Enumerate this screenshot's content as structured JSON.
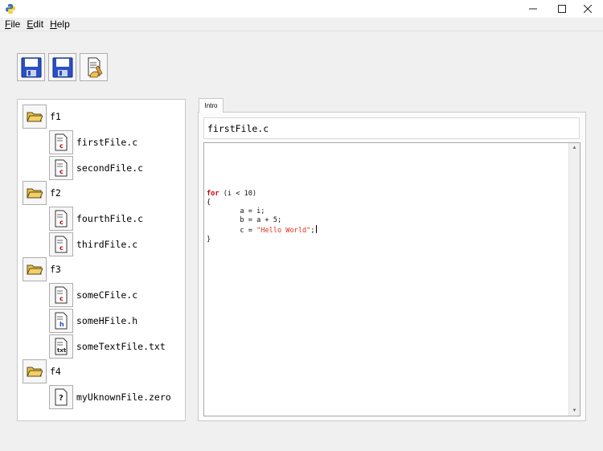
{
  "window": {
    "controls": {
      "minimize": "minimize-icon",
      "maximize": "maximize-icon",
      "close": "close-icon"
    }
  },
  "menu": [
    {
      "label": "File",
      "mnemonic": "F",
      "rest": "ile"
    },
    {
      "label": "Edit",
      "mnemonic": "E",
      "rest": "dit"
    },
    {
      "label": "Help",
      "mnemonic": "H",
      "rest": "elp"
    }
  ],
  "toolbar": {
    "buttons": [
      {
        "icon": "save-floppy-icon"
      },
      {
        "icon": "save-as-floppy-icon"
      },
      {
        "icon": "clean-document-icon"
      }
    ]
  },
  "tree": {
    "folders": [
      {
        "label": "f1",
        "files": [
          {
            "label": "firstFile.c",
            "type": "c"
          },
          {
            "label": "secondFile.c",
            "type": "c"
          }
        ]
      },
      {
        "label": "f2",
        "files": [
          {
            "label": "fourthFile.c",
            "type": "c"
          },
          {
            "label": "thirdFile.c",
            "type": "c"
          }
        ]
      },
      {
        "label": "f3",
        "files": [
          {
            "label": "someCFile.c",
            "type": "c"
          },
          {
            "label": "someHFile.h",
            "type": "h"
          },
          {
            "label": "someTextFile.txt",
            "type": "txt"
          }
        ]
      },
      {
        "label": "f4",
        "files": [
          {
            "label": "myUknownFile.zero",
            "type": "unknown"
          }
        ]
      }
    ]
  },
  "editor": {
    "tab_label": "Intro",
    "filename": "firstFile.c",
    "code": {
      "line1_kw": "for",
      "line1_rest": " (i < 10)",
      "line2": "{",
      "line3": "        a = i;",
      "line4": "        b = a + 5;",
      "line5_pre": "        c = ",
      "line5_str": "\"Hello World\"",
      "line5_post": ";",
      "line6": "}"
    }
  },
  "colors": {
    "keyword": "#c00000",
    "string": "#e0301e",
    "folder": "#f3d067",
    "floppy": "#2b4fc7"
  }
}
